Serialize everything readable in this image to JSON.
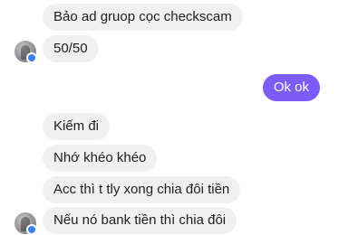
{
  "messages": [
    {
      "text": "Bảo ad gruop cọc checkscam",
      "side": "in"
    },
    {
      "text": "50/50",
      "side": "in"
    },
    {
      "text": "Ok ok",
      "side": "out"
    },
    {
      "text": "Kiếm đi",
      "side": "in"
    },
    {
      "text": "Nhớ khéo khéo",
      "side": "in"
    },
    {
      "text": "Acc thì t tly xong chia đôi tiền",
      "side": "in"
    },
    {
      "text": "Nếu nó bank tiền thì chia đôi",
      "side": "in"
    }
  ],
  "colors": {
    "incoming_bubble": "#f0f0f0",
    "outgoing_bubble": "#7b5cf6",
    "online_indicator": "#3b82f6"
  }
}
